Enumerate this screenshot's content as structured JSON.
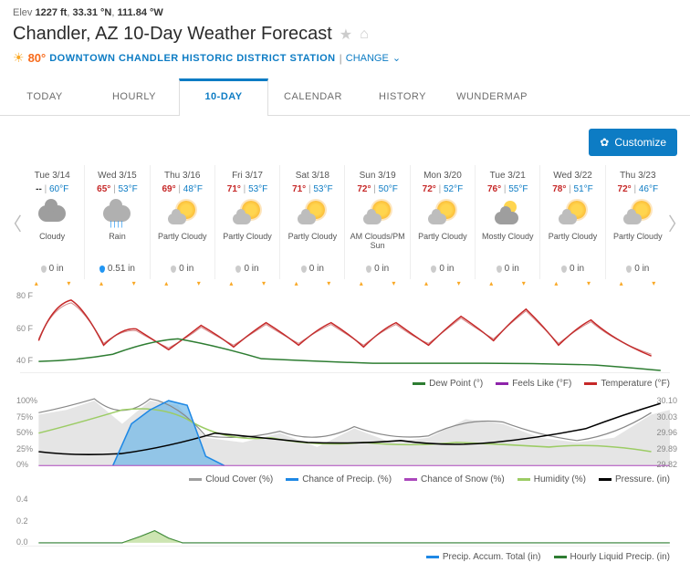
{
  "header": {
    "elev_label": "Elev",
    "elev_ft": "1227 ft",
    "lat": "33.31 °N",
    "lon": "111.84 °W",
    "title": "Chandler, AZ 10-Day Weather Forecast",
    "temp_now": "80°",
    "station": "DOWNTOWN CHANDLER HISTORIC DISTRICT STATION",
    "change": "CHANGE"
  },
  "tabs": [
    "TODAY",
    "HOURLY",
    "10-DAY",
    "CALENDAR",
    "HISTORY",
    "WUNDERMAP"
  ],
  "active_tab": 2,
  "customize": "Customize",
  "days": [
    {
      "label": "Tue 3/14",
      "hi": "--",
      "lo": "60°F",
      "icon": "cloud",
      "cond": "Cloudy",
      "precip": "0 in",
      "drop": "gray"
    },
    {
      "label": "Wed 3/15",
      "hi": "65°",
      "lo": "53°F",
      "icon": "rain",
      "cond": "Rain",
      "precip": "0.51 in",
      "drop": "blue"
    },
    {
      "label": "Thu 3/16",
      "hi": "69°",
      "lo": "48°F",
      "icon": "suncloud",
      "cond": "Partly Cloudy",
      "precip": "0 in",
      "drop": "gray"
    },
    {
      "label": "Fri 3/17",
      "hi": "71°",
      "lo": "53°F",
      "icon": "suncloud",
      "cond": "Partly Cloudy",
      "precip": "0 in",
      "drop": "gray"
    },
    {
      "label": "Sat 3/18",
      "hi": "71°",
      "lo": "53°F",
      "icon": "suncloud",
      "cond": "Partly Cloudy",
      "precip": "0 in",
      "drop": "gray"
    },
    {
      "label": "Sun 3/19",
      "hi": "72°",
      "lo": "50°F",
      "icon": "suncloud",
      "cond": "AM Clouds/PM Sun",
      "precip": "0 in",
      "drop": "gray"
    },
    {
      "label": "Mon 3/20",
      "hi": "72°",
      "lo": "52°F",
      "icon": "suncloud",
      "cond": "Partly Cloudy",
      "precip": "0 in",
      "drop": "gray"
    },
    {
      "label": "Tue 3/21",
      "hi": "76°",
      "lo": "55°F",
      "icon": "mostlycloud",
      "cond": "Mostly Cloudy",
      "precip": "0 in",
      "drop": "gray"
    },
    {
      "label": "Wed 3/22",
      "hi": "78°",
      "lo": "51°F",
      "icon": "suncloud",
      "cond": "Partly Cloudy",
      "precip": "0 in",
      "drop": "gray"
    },
    {
      "label": "Thu 3/23",
      "hi": "72°",
      "lo": "46°F",
      "icon": "suncloud",
      "cond": "Partly Cloudy",
      "precip": "0 in",
      "drop": "gray"
    }
  ],
  "chart1": {
    "yticks": [
      "80 F",
      "60 F",
      "40 F"
    ],
    "legend": [
      {
        "label": "Dew Point (°)",
        "color": "#2e7d32"
      },
      {
        "label": "Feels Like (°F)",
        "color": "#8e24aa"
      },
      {
        "label": "Temperature (°F)",
        "color": "#c62828"
      }
    ]
  },
  "chart2": {
    "yticks": [
      "100%",
      "75%",
      "50%",
      "25%",
      "0%"
    ],
    "yticks_r": [
      "30.10",
      "30.03",
      "29.96",
      "29.89",
      "29.82"
    ],
    "legend": [
      {
        "label": "Cloud Cover (%)",
        "color": "#9e9e9e"
      },
      {
        "label": "Chance of Precip. (%)",
        "color": "#1e88e5"
      },
      {
        "label": "Chance of Snow (%)",
        "color": "#ab47bc"
      },
      {
        "label": "Humidity (%)",
        "color": "#9ccc65"
      },
      {
        "label": "Pressure. (in)",
        "color": "#000"
      }
    ]
  },
  "chart3": {
    "yticks": [
      "0.4",
      "0.2",
      "0.0"
    ],
    "legend": [
      {
        "label": "Precip. Accum. Total (in)",
        "color": "#1e88e5"
      },
      {
        "label": "Hourly Liquid Precip. (in)",
        "color": "#2e7d32"
      }
    ]
  },
  "chart_data": [
    {
      "type": "line",
      "title": "Temperature / Dew Point",
      "ylabel": "°F",
      "ylim": [
        35,
        85
      ],
      "x": [
        0,
        1,
        2,
        3,
        4,
        5,
        6,
        7,
        8,
        9
      ],
      "series": [
        {
          "name": "Temperature High",
          "values": [
            80,
            65,
            69,
            71,
            71,
            72,
            72,
            76,
            78,
            72
          ]
        },
        {
          "name": "Temperature Low",
          "values": [
            60,
            53,
            48,
            53,
            53,
            50,
            52,
            55,
            51,
            46
          ]
        },
        {
          "name": "Dew Point",
          "values": [
            42,
            53,
            48,
            42,
            41,
            40,
            40,
            41,
            40,
            36
          ]
        }
      ]
    },
    {
      "type": "line",
      "title": "Humidity / Cloud / Pressure",
      "ylabel": "%",
      "ylim": [
        0,
        100
      ],
      "y2label": "in",
      "y2lim": [
        29.82,
        30.1
      ],
      "x": [
        0,
        1,
        2,
        3,
        4,
        5,
        6,
        7,
        8,
        9
      ],
      "series": [
        {
          "name": "Cloud Cover",
          "values": [
            80,
            90,
            40,
            35,
            30,
            45,
            40,
            70,
            35,
            30
          ]
        },
        {
          "name": "Chance of Precip",
          "values": [
            5,
            75,
            5,
            0,
            0,
            0,
            0,
            5,
            0,
            0
          ]
        },
        {
          "name": "Humidity",
          "values": [
            50,
            80,
            55,
            45,
            40,
            40,
            38,
            40,
            35,
            30
          ]
        },
        {
          "name": "Pressure",
          "axis": "y2",
          "values": [
            29.88,
            29.85,
            29.98,
            29.95,
            29.92,
            29.9,
            29.93,
            29.9,
            29.95,
            30.05
          ]
        }
      ]
    },
    {
      "type": "area",
      "title": "Precipitation",
      "ylabel": "in",
      "ylim": [
        0,
        0.5
      ],
      "x": [
        0,
        1,
        2,
        3,
        4,
        5,
        6,
        7,
        8,
        9
      ],
      "series": [
        {
          "name": "Hourly Liquid Precip",
          "values": [
            0,
            0.08,
            0.01,
            0,
            0,
            0,
            0,
            0,
            0,
            0
          ]
        }
      ]
    }
  ]
}
